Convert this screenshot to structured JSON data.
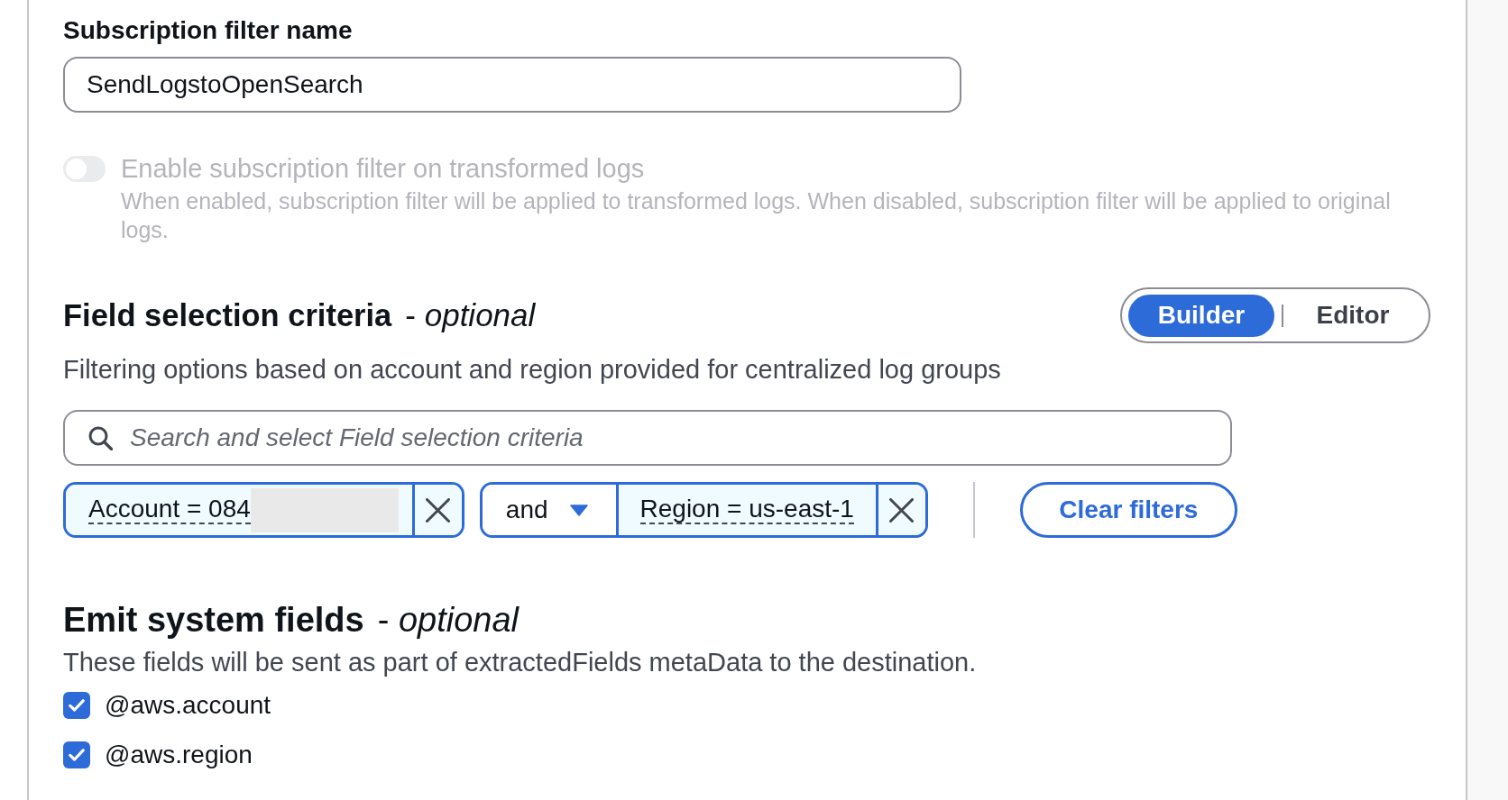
{
  "subscription_filter_name": {
    "label": "Subscription filter name",
    "value": "SendLogstoOpenSearch"
  },
  "transformed_logs_toggle": {
    "label": "Enable subscription filter on transformed logs",
    "description": "When enabled, subscription filter will be applied to transformed logs. When disabled, subscription filter will be applied to original logs.",
    "on": false,
    "disabled": true
  },
  "field_selection_criteria": {
    "title": "Field selection criteria",
    "qualifier": "- *optional*",
    "mode_tabs": [
      {
        "label": "Builder",
        "selected": true
      },
      {
        "label": "Editor",
        "selected": false
      }
    ],
    "description": "Filtering options based on account and region provided for centralized log groups",
    "search": {
      "placeholder": "Search and select Field selection criteria"
    },
    "filter_tokens": [
      {
        "label": "Account = 084",
        "redacted": true
      },
      {
        "operator": "and",
        "label": "Region = us-east-1",
        "redacted": false
      }
    ],
    "clear_button": "Clear filters"
  },
  "emit_system_fields": {
    "title": "Emit system fields",
    "qualifier": "- *optional*",
    "description": "These fields will be sent as part of extractedFields metaData to the destination.",
    "fields": [
      {
        "label": "@aws.account",
        "checked": true
      },
      {
        "label": "@aws.region",
        "checked": true
      }
    ]
  }
}
